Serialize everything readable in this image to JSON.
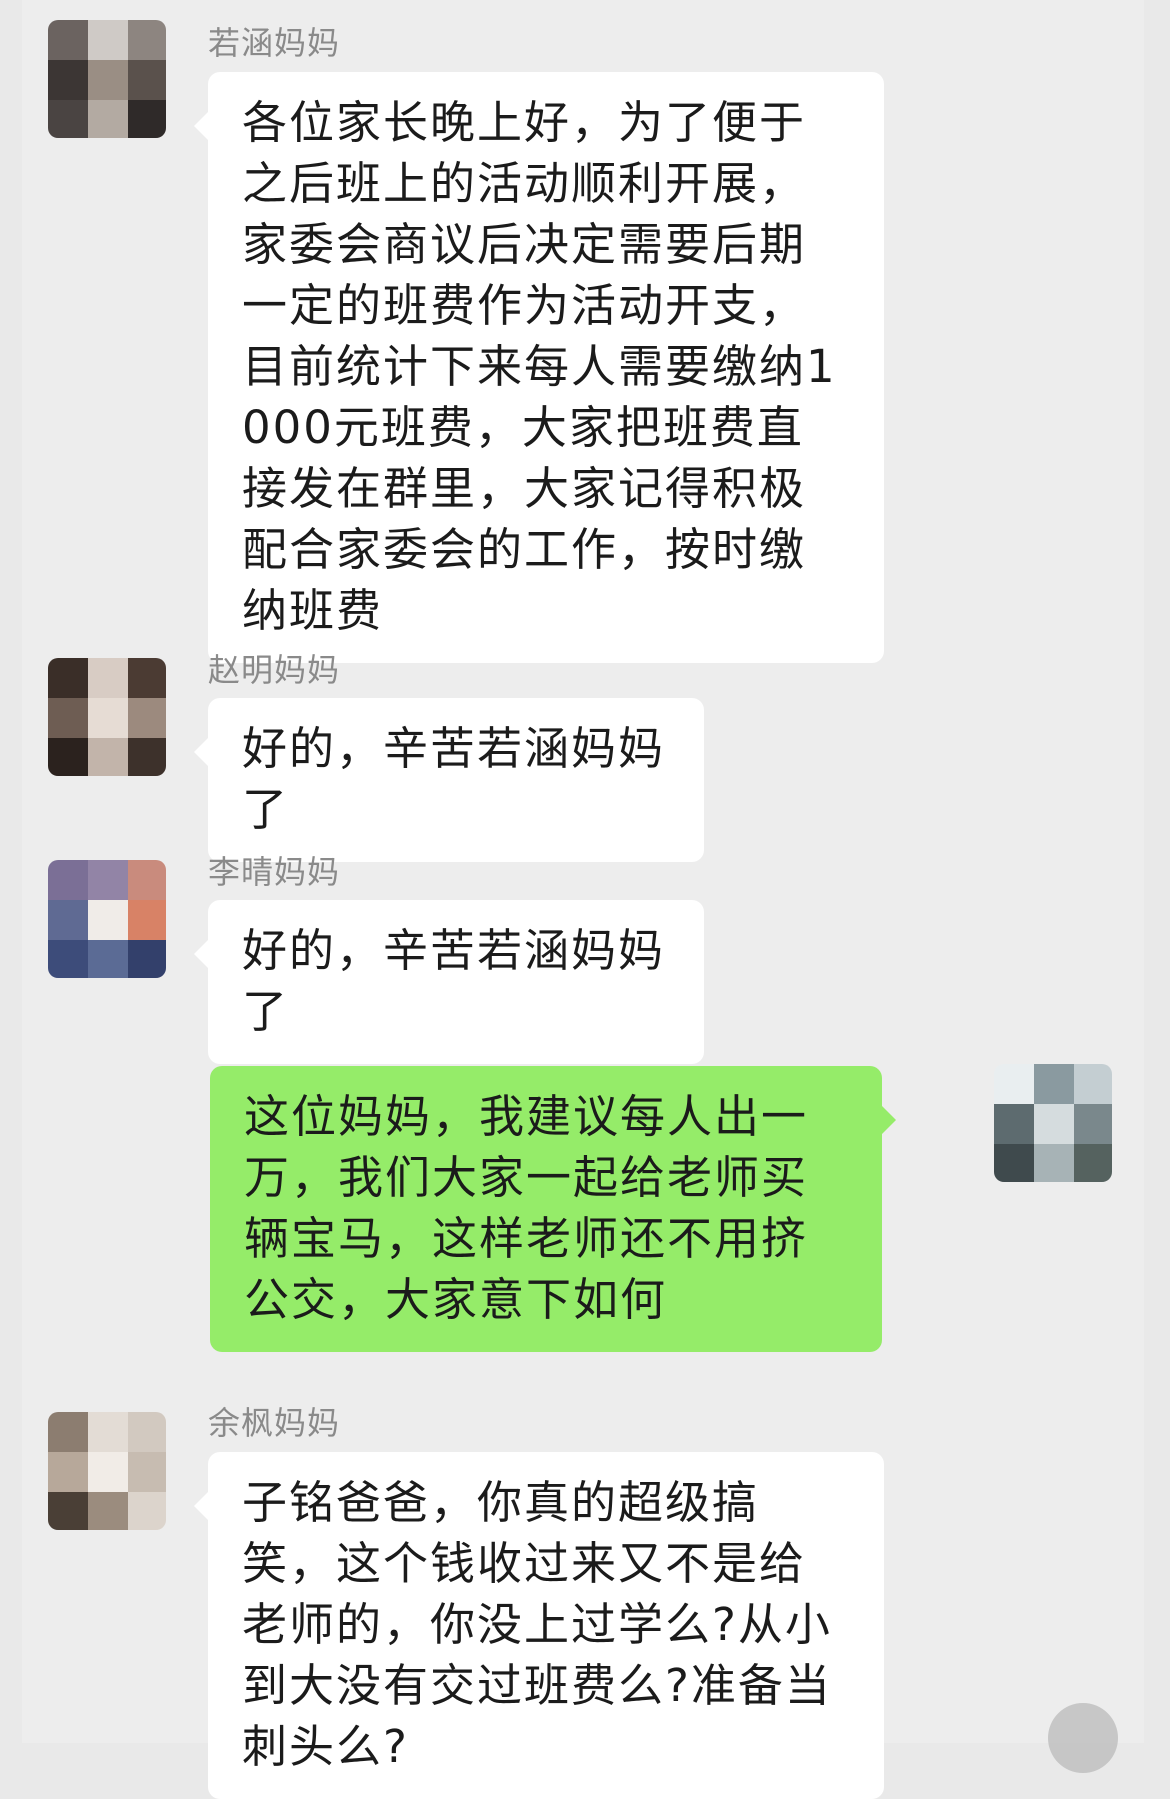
{
  "colors": {
    "background": "#ededed",
    "incoming_bubble": "#ffffff",
    "outgoing_bubble": "#95ec69",
    "sender_name": "#8a8a8a",
    "message_text": "#1b1b1b"
  },
  "messages": [
    {
      "sender": "若涵妈妈",
      "text": "各位家长晚上好，为了便于之后班上的活动顺利开展，家委会商议后决定需要后期一定的班费作为活动开支，目前统计下来每人需要缴纳1000元班费，大家把班费直接发在群里，大家记得积极配合家委会的工作，按时缴纳班费",
      "avatar_icon": "avatar-pixelated"
    },
    {
      "sender": "赵明妈妈",
      "text": "好的，辛苦若涵妈妈了",
      "avatar_icon": "avatar-pixelated"
    },
    {
      "sender": "李晴妈妈",
      "text": "好的，辛苦若涵妈妈了",
      "avatar_icon": "avatar-pixelated"
    },
    {
      "sender": "",
      "text": "这位妈妈，我建议每人出一万，我们大家一起给老师买辆宝马，这样老师还不用挤公交，大家意下如何",
      "avatar_icon": "avatar-pixelated",
      "outgoing": true
    },
    {
      "sender": "余枫妈妈",
      "text": "子铭爸爸，你真的超级搞笑，这个钱收过来又不是给老师的，你没上过学么?从小到大没有交过班费么?准备当刺头么?",
      "avatar_icon": "avatar-pixelated"
    }
  ]
}
